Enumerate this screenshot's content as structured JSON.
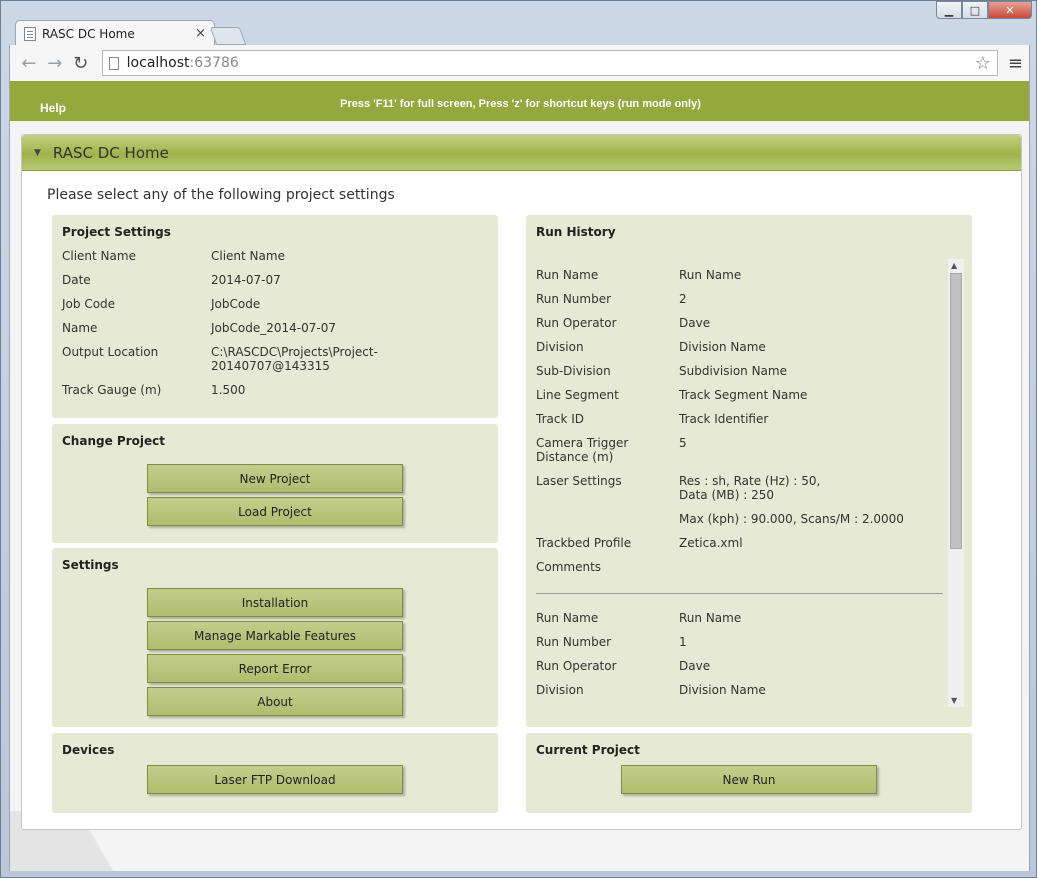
{
  "browser": {
    "tab_title": "RASC DC Home",
    "tab_close": "×",
    "url_host": "localhost",
    "url_port": ":63786",
    "win_min": "▁",
    "win_max": "□",
    "win_close": "✕"
  },
  "topbar": {
    "help": "Help",
    "hint": "Press 'F11' for full screen, Press 'z' for shortcut keys (run mode only)"
  },
  "panel": {
    "title": "RASC DC Home",
    "intro": "Please select any of the following project settings"
  },
  "project_settings": {
    "title": "Project Settings",
    "rows": [
      {
        "label": "Client Name",
        "value": "Client Name"
      },
      {
        "label": "Date",
        "value": "2014-07-07"
      },
      {
        "label": "Job Code",
        "value": "JobCode"
      },
      {
        "label": "Name",
        "value": "JobCode_2014-07-07"
      },
      {
        "label": "Output Location",
        "value": "C:\\RASCDC\\Projects\\Project-",
        "value2": "20140707@143315"
      },
      {
        "label": "Track Gauge (m)",
        "value": "1.500"
      }
    ]
  },
  "change_project": {
    "title": "Change Project",
    "new_project": "New Project",
    "load_project": "Load Project"
  },
  "settings": {
    "title": "Settings",
    "installation": "Installation",
    "manage_markable": "Manage Markable Features",
    "report_error": "Report Error",
    "about": "About"
  },
  "devices": {
    "title": "Devices",
    "laser_ftp": "Laser FTP Download"
  },
  "run_history": {
    "title": "Run History",
    "run1": {
      "run_name_label": "Run Name",
      "run_name": "Run Name",
      "run_number_label": "Run Number",
      "run_number": "2",
      "run_operator_label": "Run Operator",
      "run_operator": "Dave",
      "division_label": "Division",
      "division": "Division Name",
      "subdivision_label": "Sub-Division",
      "subdivision": "Subdivision Name",
      "line_segment_label": "Line Segment",
      "line_segment": "Track Segment Name",
      "track_id_label": "Track ID",
      "track_id": "Track Identifier",
      "camera_label_1": "Camera Trigger",
      "camera_label_2": "Distance (m)",
      "camera": "5",
      "laser_label": "Laser Settings",
      "laser_1": "Res : sh, Rate (Hz) : 50,",
      "laser_2": "Data (MB) : 250",
      "laser_3": "Max (kph) : 90.000, Scans/M : 2.0000",
      "trackbed_label": "Trackbed Profile",
      "trackbed": "Zetica.xml",
      "comments_label": "Comments"
    },
    "run2": {
      "run_name_label": "Run Name",
      "run_name": "Run Name",
      "run_number_label": "Run Number",
      "run_number": "1",
      "run_operator_label": "Run Operator",
      "run_operator": "Dave",
      "division_label": "Division",
      "division": "Division Name"
    }
  },
  "current_project": {
    "title": "Current Project",
    "new_run": "New Run"
  }
}
